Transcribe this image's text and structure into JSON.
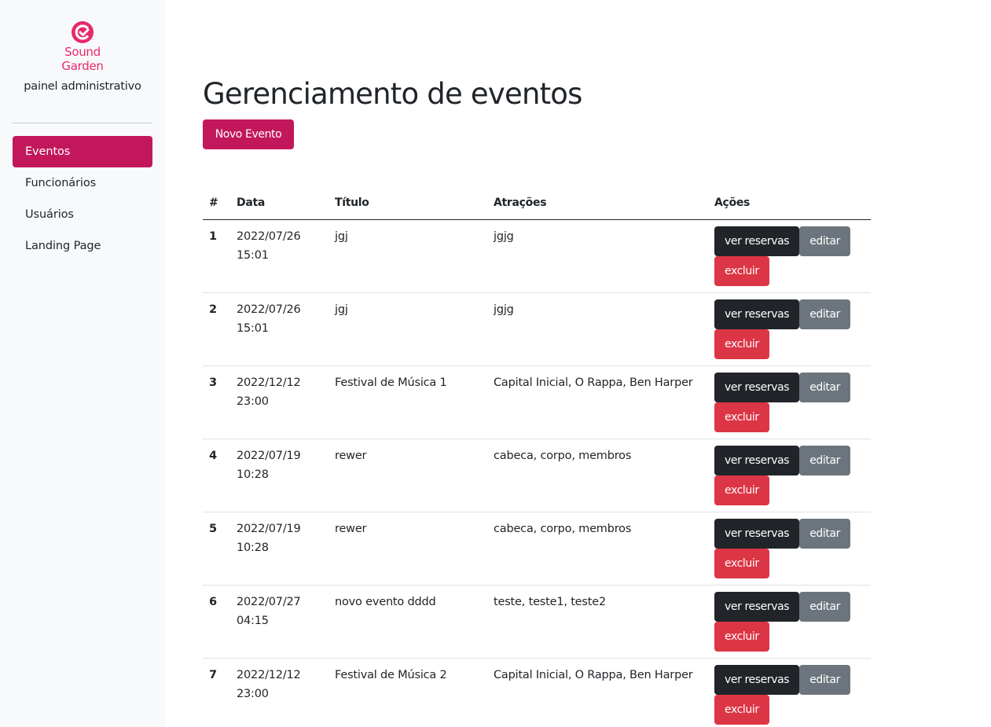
{
  "brand": {
    "logo_line1": "Sound",
    "logo_line2": "Garden",
    "subtitle": "painel administrativo",
    "accent_color": "#c2185b",
    "logo_color": "#e8286b"
  },
  "sidebar": {
    "items": [
      {
        "label": "Eventos",
        "active": true
      },
      {
        "label": "Funcionários",
        "active": false
      },
      {
        "label": "Usuários",
        "active": false
      },
      {
        "label": "Landing Page",
        "active": false
      }
    ]
  },
  "main": {
    "title": "Gerenciamento de eventos",
    "new_button": "Novo Evento"
  },
  "table": {
    "headers": [
      "#",
      "Data",
      "Título",
      "Atrações",
      "Ações"
    ],
    "actions": {
      "view": "ver reservas",
      "edit": "editar",
      "delete": "excluir"
    },
    "rows": [
      {
        "num": "1",
        "date": "2022/07/26",
        "time": "15:01",
        "title": "jgj",
        "attractions": "jgjg"
      },
      {
        "num": "2",
        "date": "2022/07/26",
        "time": "15:01",
        "title": "jgj",
        "attractions": "jgjg"
      },
      {
        "num": "3",
        "date": "2022/12/12",
        "time": "23:00",
        "title": "Festival de Música 1",
        "attractions": "Capital Inicial, O Rappa, Ben Harper"
      },
      {
        "num": "4",
        "date": "2022/07/19",
        "time": "10:28",
        "title": "rewer",
        "attractions": "cabeca, corpo, membros"
      },
      {
        "num": "5",
        "date": "2022/07/19",
        "time": "10:28",
        "title": "rewer",
        "attractions": "cabeca, corpo, membros"
      },
      {
        "num": "6",
        "date": "2022/07/27",
        "time": "04:15",
        "title": "novo evento dddd",
        "attractions": "teste, teste1, teste2"
      },
      {
        "num": "7",
        "date": "2022/12/12",
        "time": "23:00",
        "title": "Festival de Música 2",
        "attractions": "Capital Inicial, O Rappa, Ben Harper"
      }
    ]
  }
}
